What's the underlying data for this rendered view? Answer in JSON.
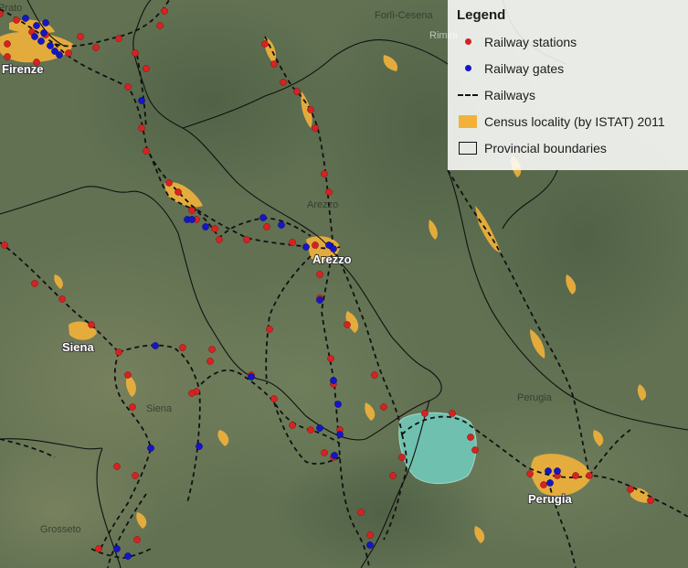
{
  "legend": {
    "title": "Legend",
    "items": [
      {
        "label": "Railway stations",
        "symbol": "red-dot",
        "color": "#d62222"
      },
      {
        "label": "Railway gates",
        "symbol": "blue-dot",
        "color": "#1515c8"
      },
      {
        "label": "Railways",
        "symbol": "black-dashed-line",
        "color": "#111111"
      },
      {
        "label": "Census locality (by ISTAT) 2011",
        "symbol": "orange-fill",
        "color": "#f2b23a"
      },
      {
        "label": "Provincial boundaries",
        "symbol": "outline-box",
        "color": "#111111"
      }
    ]
  },
  "cities": {
    "firenze": "Firenze",
    "arezzo": "Arezzo",
    "siena": "Siena",
    "perugia": "Perugia"
  },
  "provinces": {
    "prato": "Prato",
    "forli": "Forlì-Cesena",
    "rimini": "Rimini",
    "arezzo": "Arezzo",
    "siena": "Siena",
    "perugia": "Perugia",
    "grosseto": "Grosseto"
  },
  "lake_color": "#6fc0ae"
}
